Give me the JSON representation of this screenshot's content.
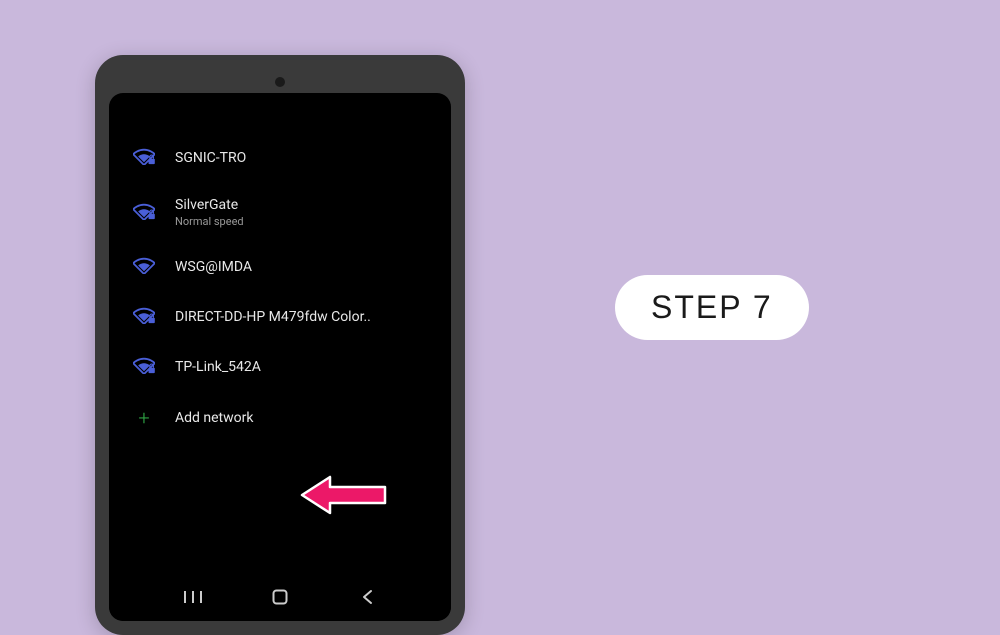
{
  "step_label": "STEP 7",
  "networks": [
    {
      "name": "SGNIC-TRO",
      "subtitle": "",
      "secured": true
    },
    {
      "name": "SilverGate",
      "subtitle": "Normal speed",
      "secured": true
    },
    {
      "name": "WSG@IMDA",
      "subtitle": "",
      "secured": false
    },
    {
      "name": "DIRECT-DD-HP M479fdw Color..",
      "subtitle": "",
      "secured": true
    },
    {
      "name": "TP-Link_542A",
      "subtitle": "",
      "secured": true
    }
  ],
  "add_network_label": "Add network",
  "colors": {
    "wifi_icon": "#4a5fd8",
    "plus_icon": "#2ea043",
    "arrow": "#e91e63"
  }
}
